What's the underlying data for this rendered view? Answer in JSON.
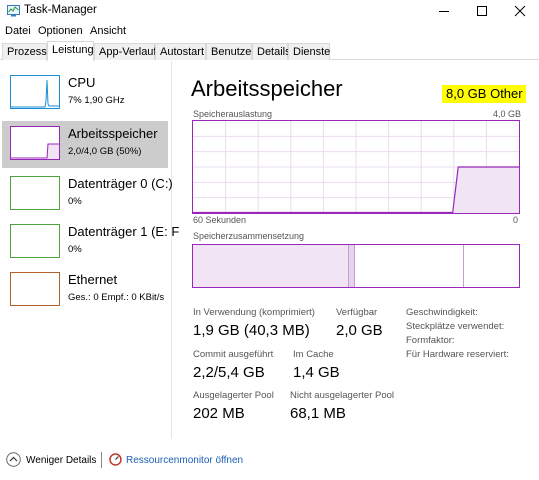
{
  "window": {
    "title": "Task-Manager",
    "icon": "task-manager-icon"
  },
  "menu": [
    "Datei",
    "Optionen",
    "Ansicht"
  ],
  "tabs": [
    "Prozesse",
    "Leistung",
    "App-Verlauf",
    "Autostart",
    "Benutzer",
    "Details",
    "Dienste"
  ],
  "active_tab": "Leistung",
  "resources": [
    {
      "name": "CPU",
      "sub": "7%  1,90 GHz",
      "color": "#1a8fd6"
    },
    {
      "name": "Arbeitsspeicher",
      "sub": "2,0/4,0 GB (50%)",
      "color": "#9728b9"
    },
    {
      "name": "Datenträger 0 (C:)",
      "sub": "0%",
      "color": "#4da33d"
    },
    {
      "name": "Datenträger 1 (E: F",
      "sub": "0%",
      "color": "#4da33d"
    },
    {
      "name": "Ethernet",
      "sub": "Ges.: 0  Empf.: 0 KBit/s",
      "color": "#b1622a"
    }
  ],
  "main": {
    "title": "Arbeitsspeicher",
    "total": "8,0 GB Other",
    "usage_label": "Speicherauslastung",
    "usage_max": "4,0 GB",
    "time_left": "60 Sekunden",
    "time_right": "0",
    "composition_label": "Speicherzusammensetzung"
  },
  "stats": {
    "in_use_label": "In Verwendung (komprimiert)",
    "in_use_value": "1,9 GB (40,3 MB)",
    "available_label": "Verfügbar",
    "available_value": "2,0 GB",
    "committed_label": "Commit ausgeführt",
    "committed_value": "2,2/5,4 GB",
    "cached_label": "Im Cache",
    "cached_value": "1,4 GB",
    "paged_label": "Ausgelagerter Pool",
    "paged_value": "202 MB",
    "nonpaged_label": "Nicht ausgelagerter Pool",
    "nonpaged_value": "68,1 MB"
  },
  "meta": {
    "speed": "Geschwindigkeit:",
    "slots": "Steckplätze verwendet:",
    "form_factor": "Formfaktor:",
    "reserved": "Für Hardware reserviert:"
  },
  "footer": {
    "fewer_details": "Weniger Details",
    "resource_monitor": "Ressourcenmonitor öffnen"
  },
  "usage_history": [
    0,
    0,
    0,
    0,
    0,
    0,
    0,
    0,
    0,
    0,
    0,
    0,
    0,
    0,
    0,
    0,
    0,
    0,
    0,
    0,
    0,
    0,
    0,
    0,
    0,
    0,
    0,
    0,
    0,
    0,
    0,
    0,
    0,
    0,
    0,
    0,
    0,
    0,
    0,
    0,
    0,
    0,
    0,
    0,
    0,
    0,
    0,
    0,
    0.5,
    0.5,
    0.5,
    0.5,
    0.5,
    0.5,
    0.5,
    0.5,
    0.5,
    0.5,
    0.5,
    0.5
  ]
}
